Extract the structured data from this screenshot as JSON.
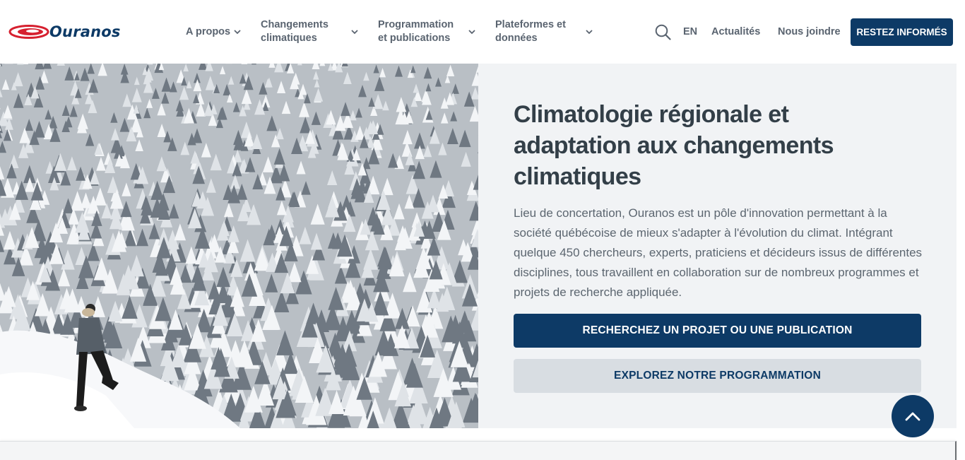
{
  "brand": {
    "name": "Ouranos",
    "primary_color": "#0d3a66",
    "logo_accent_color": "#d6202f"
  },
  "nav": {
    "items": [
      {
        "label_line1": "A propos",
        "label_line2": "",
        "icon": "chevron-down-icon"
      },
      {
        "label_line1": "Changements",
        "label_line2": "climatiques",
        "icon": "chevron-down-icon"
      },
      {
        "label_line1": "Programmation",
        "label_line2": "et publications",
        "icon": "chevron-down-icon"
      },
      {
        "label_line1": "Plateformes et",
        "label_line2": "données",
        "icon": "chevron-down-icon"
      }
    ],
    "search_icon": "search-icon",
    "lang": "EN",
    "news": "Actualités",
    "contact": "Nous joindre",
    "cta": "RESTEZ INFORMÉS"
  },
  "hero": {
    "title": "Climatologie régionale et adaptation aux changements climatiques",
    "description": "Lieu de concertation, Ouranos est un pôle d'innovation permettant à la société québécoise de mieux s'adapter à l'évolution du climat. Intégrant quelque 450 chercheurs, experts, praticiens et décideurs issus de différentes disciplines, tous travaillent en collaboration sur de nombreux programmes et projets de recherche appliquée.",
    "primary_button": "RECHERCHEZ UN PROJET OU UNE PUBLICATION",
    "secondary_button": "EXPLOREZ NOTRE PROGRAMMATION",
    "image_icon": "snowy-forest-hiker-photo",
    "scroll_top_icon": "chevron-up-icon"
  }
}
